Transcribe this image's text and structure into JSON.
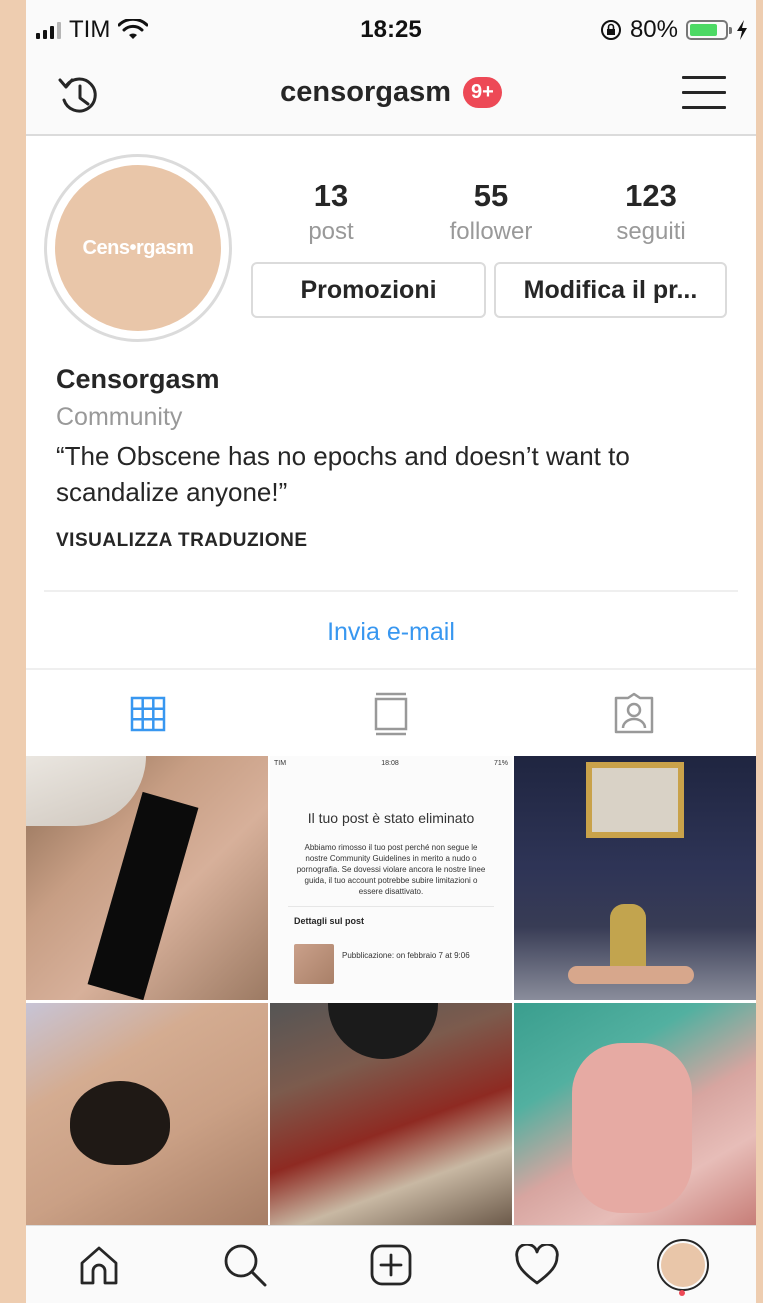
{
  "colors": {
    "background": "#EECDB0",
    "link_blue": "#3897f0",
    "badge_red": "#ed4956",
    "muted_gray": "#999999",
    "avatar_bg": "#e9c6a9"
  },
  "status_bar": {
    "carrier": "TIM",
    "time": "18:25",
    "battery": "80%",
    "battery_level": 0.8,
    "icons": [
      "signal-icon",
      "wifi-icon",
      "rotation-lock-icon",
      "battery-icon",
      "charging-icon"
    ]
  },
  "header": {
    "username": "censorgasm",
    "badge": "9+",
    "left_icon": "history-icon",
    "right_icon": "menu-icon"
  },
  "profile": {
    "avatar_text": "Cens•rgasm",
    "stats": [
      {
        "value": "13",
        "label": "post"
      },
      {
        "value": "55",
        "label": "follower"
      },
      {
        "value": "123",
        "label": "seguiti"
      }
    ],
    "buttons": {
      "promo": "Promozioni",
      "edit": "Modifica il pr..."
    },
    "name": "Censorgasm",
    "category": "Community",
    "bio": "“The Obscene has no epochs and doesn’t want to scandalize anyone!”",
    "translate": "VISUALIZZA TRADUZIONE",
    "email": "Invia e-mail"
  },
  "tabs": [
    {
      "name": "grid",
      "icon": "grid-icon",
      "active": true
    },
    {
      "name": "list",
      "icon": "list-view-icon",
      "active": false
    },
    {
      "name": "tagged",
      "icon": "tagged-photos-icon",
      "active": false
    }
  ],
  "grid": {
    "post2": {
      "carrier": "TIM",
      "time": "18:08",
      "battery": "71%",
      "title": "Il tuo post è stato eliminato",
      "body": "Abbiamo rimosso il tuo post perché non segue le nostre Community Guidelines in merito a nudo o pornografia. Se dovessi violare ancora le nostre linee guida, il tuo account potrebbe subire limitazioni o essere disattivato.",
      "details_heading": "Dettagli sul post",
      "published": "Pubblicazione: on febbraio 7 at 9:06"
    }
  },
  "bottom_nav": [
    {
      "name": "home",
      "icon": "home-icon"
    },
    {
      "name": "search",
      "icon": "search-icon"
    },
    {
      "name": "new-post",
      "icon": "add-post-icon"
    },
    {
      "name": "activity",
      "icon": "heart-icon"
    },
    {
      "name": "profile",
      "icon": "profile-avatar-icon"
    }
  ]
}
